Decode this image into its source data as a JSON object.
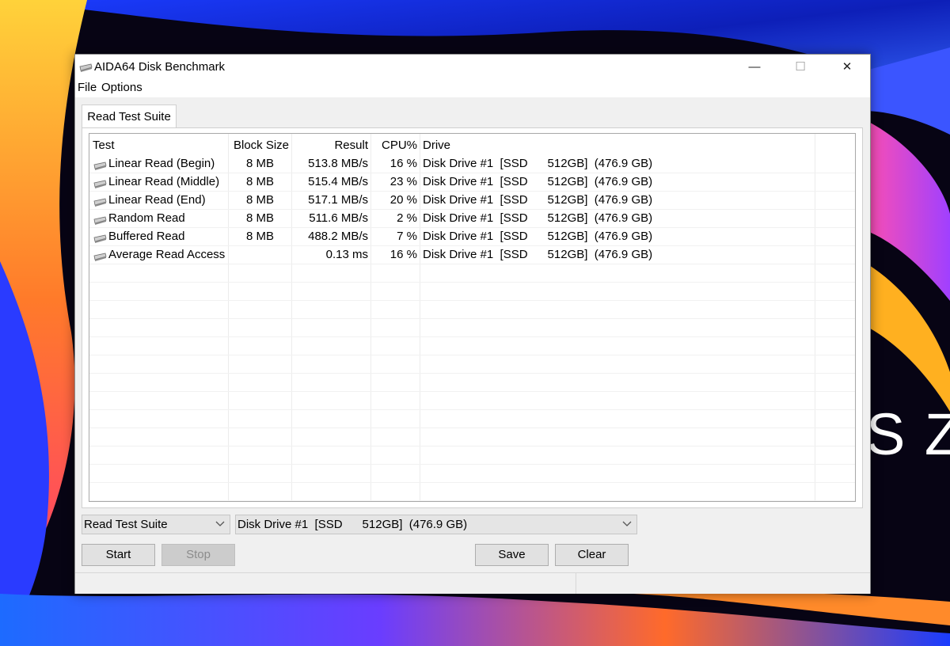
{
  "wallpaper": {
    "brand_text": "S Ze"
  },
  "window": {
    "title": "AIDA64 Disk Benchmark",
    "controls": {
      "minimize": "—",
      "maximize": "☐",
      "close": "✕"
    }
  },
  "menu": {
    "items": [
      "File",
      "Options"
    ]
  },
  "tabs": [
    {
      "label": "Read Test Suite"
    }
  ],
  "table": {
    "headers": {
      "test": "Test",
      "block_size": "Block Size",
      "result": "Result",
      "cpu": "CPU%",
      "drive": "Drive"
    },
    "rows": [
      {
        "test": "Linear Read (Begin)",
        "block_size": "8 MB",
        "result": "513.8 MB/s",
        "cpu": "16 %",
        "drive": "Disk Drive #1  [SSD      512GB]  (476.9 GB)"
      },
      {
        "test": "Linear Read (Middle)",
        "block_size": "8 MB",
        "result": "515.4 MB/s",
        "cpu": "23 %",
        "drive": "Disk Drive #1  [SSD      512GB]  (476.9 GB)"
      },
      {
        "test": "Linear Read (End)",
        "block_size": "8 MB",
        "result": "517.1 MB/s",
        "cpu": "20 %",
        "drive": "Disk Drive #1  [SSD      512GB]  (476.9 GB)"
      },
      {
        "test": "Random Read",
        "block_size": "8 MB",
        "result": "511.6 MB/s",
        "cpu": "2 %",
        "drive": "Disk Drive #1  [SSD      512GB]  (476.9 GB)"
      },
      {
        "test": "Buffered Read",
        "block_size": "8 MB",
        "result": "488.2 MB/s",
        "cpu": "7 %",
        "drive": "Disk Drive #1  [SSD      512GB]  (476.9 GB)"
      },
      {
        "test": "Average Read Access",
        "block_size": "",
        "result": "0.13 ms",
        "cpu": "16 %",
        "drive": "Disk Drive #1  [SSD      512GB]  (476.9 GB)"
      }
    ]
  },
  "controls": {
    "suite_select": {
      "value": "Read Test Suite"
    },
    "drive_select": {
      "value": "Disk Drive #1  [SSD      512GB]  (476.9 GB)"
    },
    "start_label": "Start",
    "stop_label": "Stop",
    "save_label": "Save",
    "clear_label": "Clear"
  },
  "colors": {
    "window_bg": "#f0f0f0",
    "titlebar_bg": "#ffffff",
    "button_bg": "#e1e1e1",
    "button_disabled_bg": "#cccccc"
  }
}
